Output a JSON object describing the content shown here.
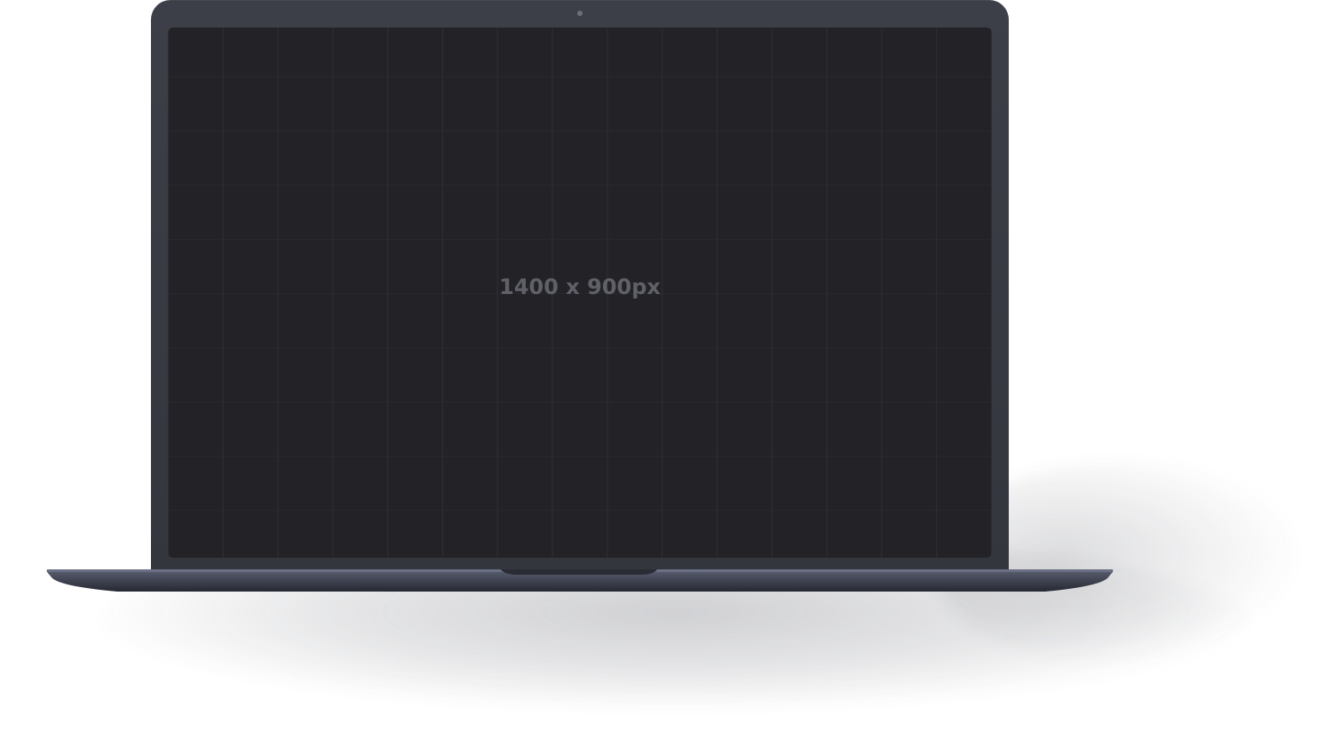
{
  "screen": {
    "label": "1400 x 900px"
  },
  "colors": {
    "lid": "#3a3c45",
    "screen": "#232327",
    "grid_line": "#2e2e33",
    "label": "#5f6068",
    "base_top": "#5a5f72",
    "base_body": "#2d2f3a"
  },
  "icons": {
    "camera": "camera-dot-icon"
  }
}
